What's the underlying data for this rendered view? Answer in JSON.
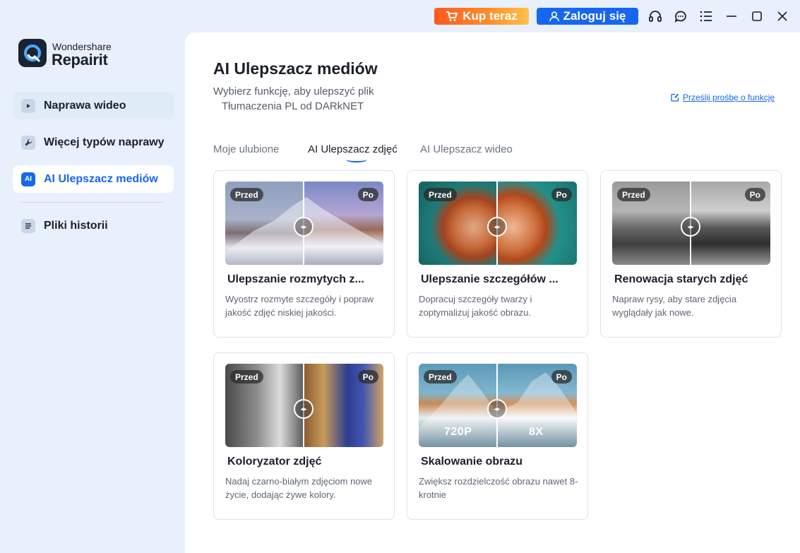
{
  "topbar": {
    "buy_label": "Kup teraz",
    "login_label": "Zaloguj się"
  },
  "logo": {
    "small": "Wondershare",
    "big": "Repairit"
  },
  "sidebar": {
    "items": [
      {
        "label": "Naprawa wideo"
      },
      {
        "label": "Więcej typów naprawy"
      },
      {
        "label": "AI Ulepszacz mediów",
        "icon_text": "AI"
      },
      {
        "label": "Pliki historii"
      }
    ]
  },
  "main": {
    "title": "AI Ulepszacz mediów",
    "subtitle_line1": "Wybierz funkcję, aby ulepszyć plik",
    "subtitle_line2": "Tłumaczenia PL od DARkNET",
    "feature_link": "Prześlij prośbę o funkcję",
    "tabs": [
      {
        "label": "Moje ulubione"
      },
      {
        "label": "AI Ulepszacz zdjęć"
      },
      {
        "label": "AI Ulepszacz wideo"
      }
    ],
    "before_label": "Przed",
    "after_label": "Po",
    "cards": [
      {
        "title": "Ulepszanie rozmytych z...",
        "desc": "Wyostrz rozmyte szczegóły i popraw jakość zdjęć niskiej jakości."
      },
      {
        "title": "Ulepszanie szczegółów ...",
        "desc": "Dopracuj szczegóły twarzy i zoptymalizuj jakość obrazu."
      },
      {
        "title": "Renowacja starych zdjęć",
        "desc": "Napraw rysy, aby stare zdjęcia wyglądały jak nowe."
      },
      {
        "title": "Koloryzator zdjęć",
        "desc": "Nadaj czarno-białym zdjęciom nowe życie, dodając żywe kolory."
      },
      {
        "title": "Skalowanie obrazu",
        "desc": "Zwiększ rozdzielczość obrazu nawet 8-krotnie",
        "res_before": "720P",
        "res_after": "8X"
      }
    ]
  },
  "colors": {
    "accent": "#1766f0",
    "buy_gradient_start": "#ff5a1f",
    "buy_gradient_end": "#ffc24a",
    "sidebar_bg": "#e7f0fb"
  }
}
